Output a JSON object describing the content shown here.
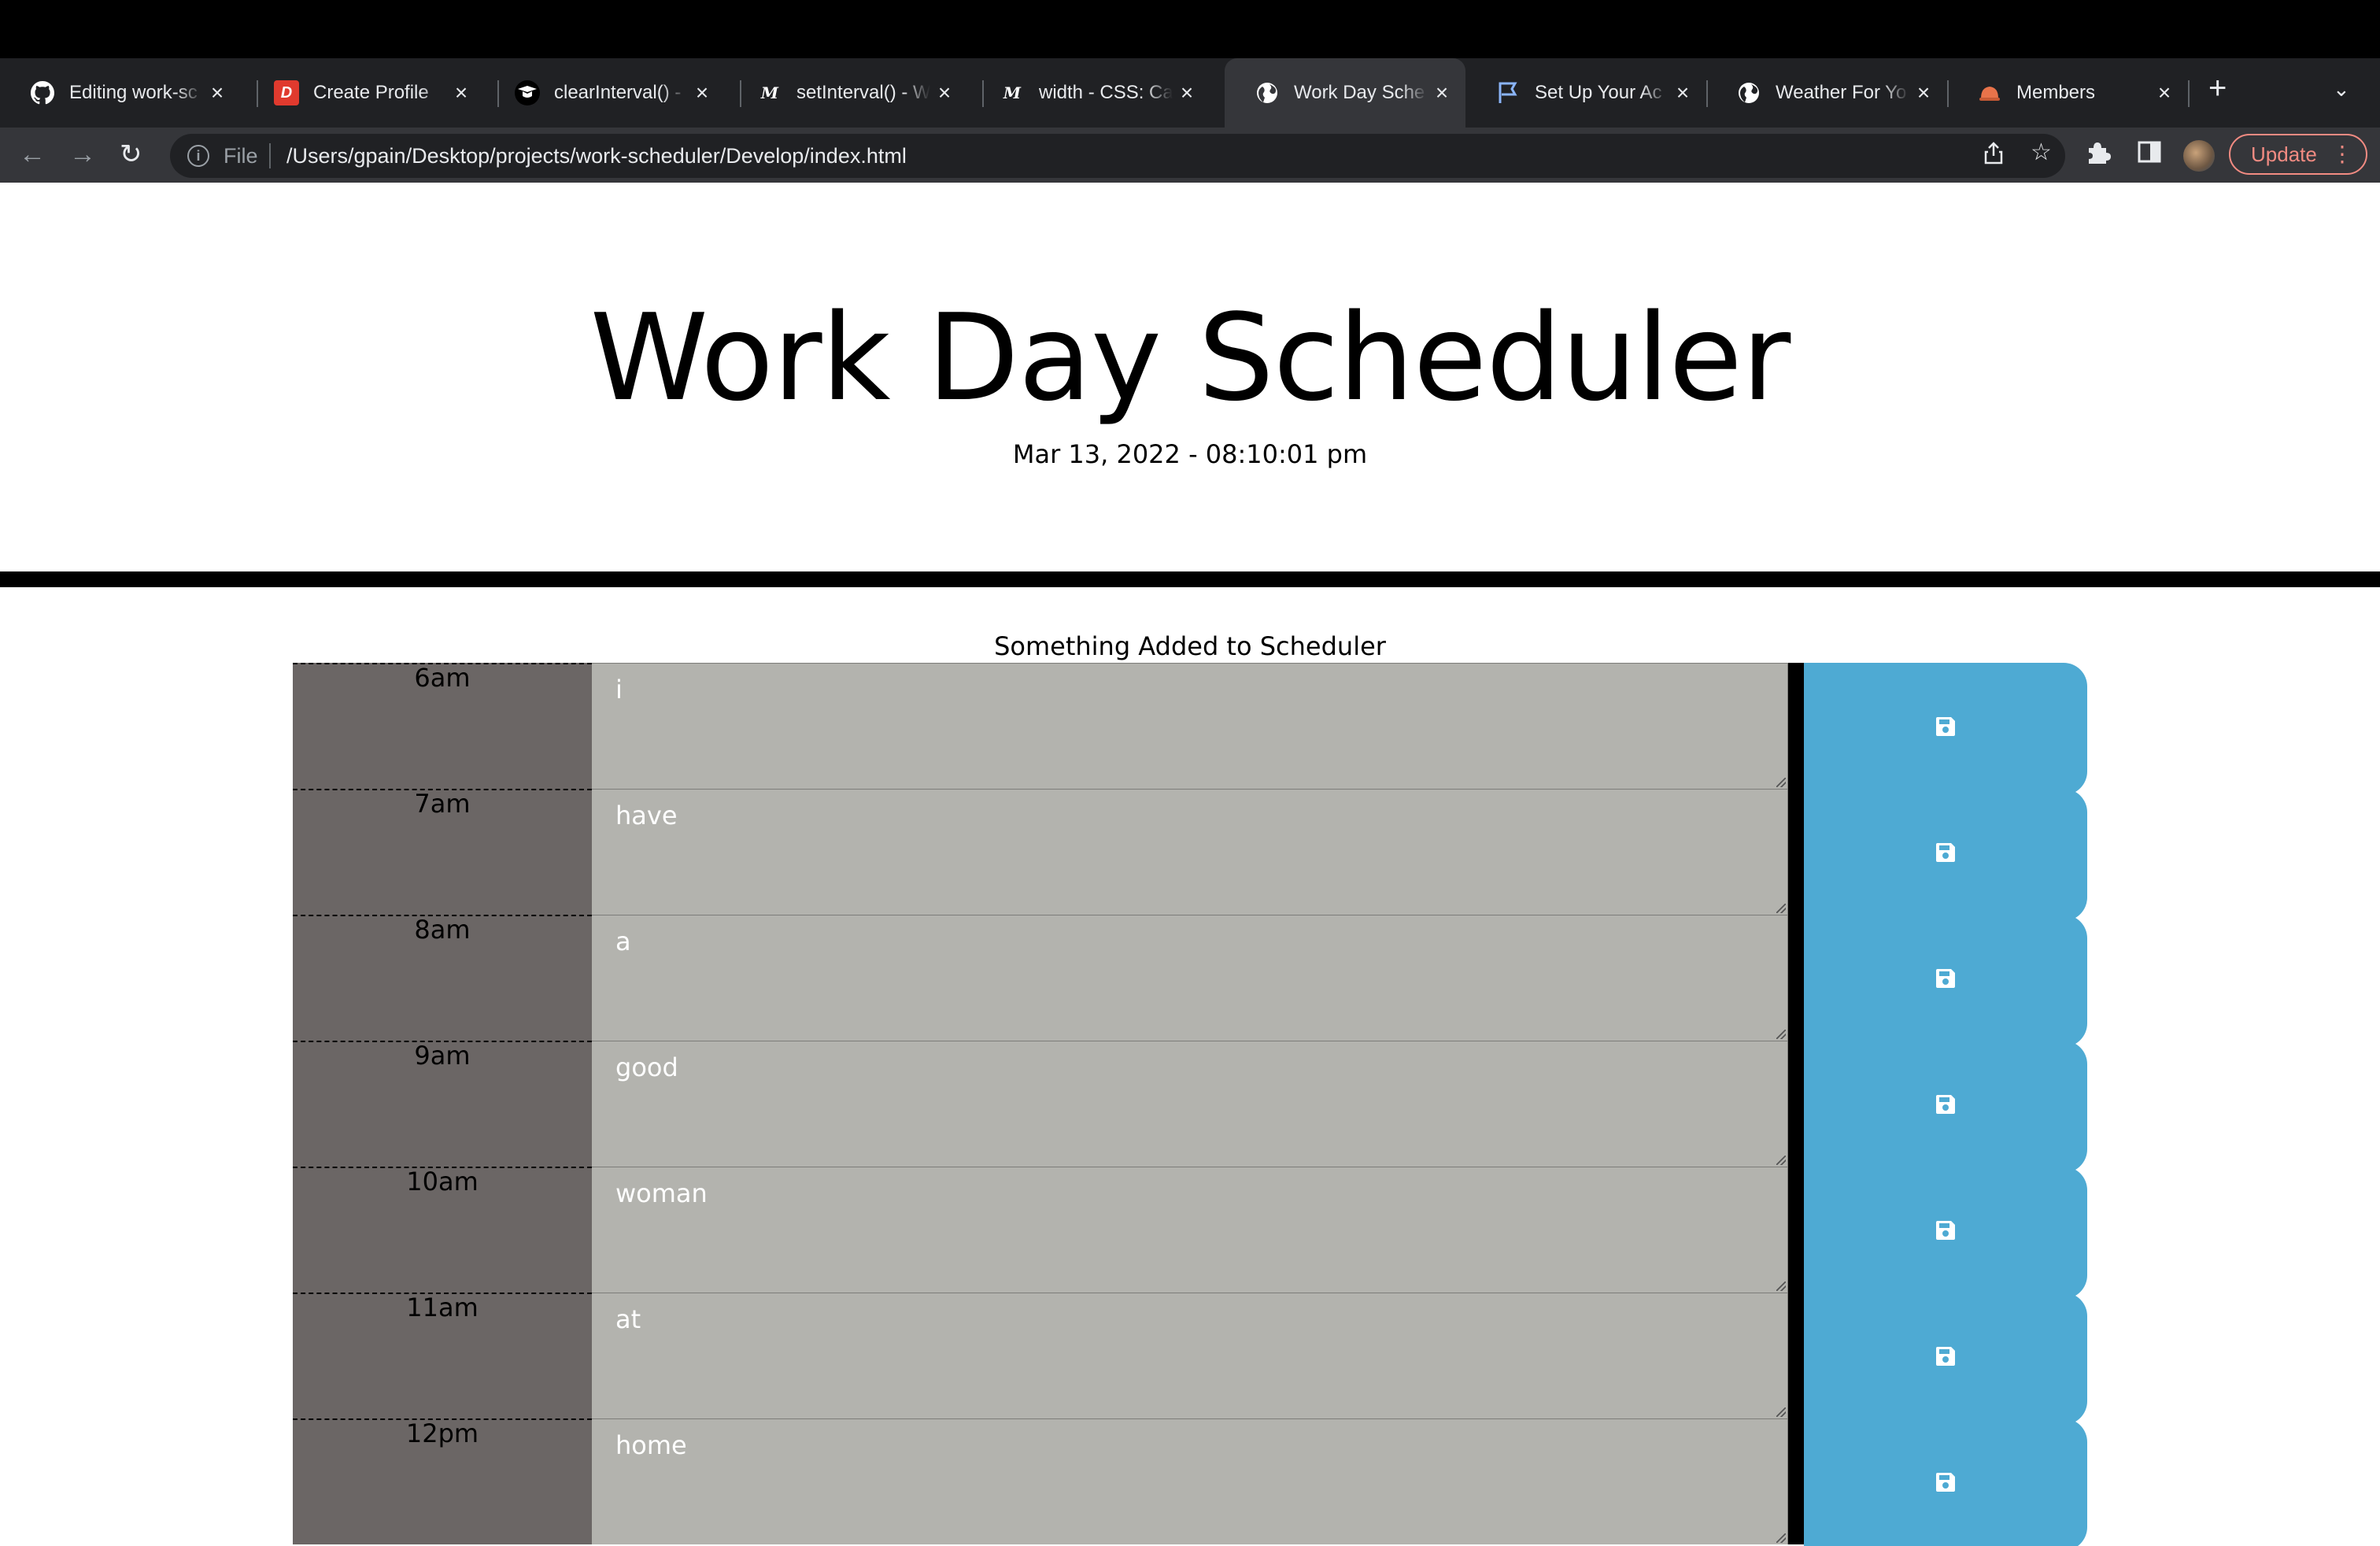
{
  "browser": {
    "tabs": [
      {
        "title": "Editing work-sc",
        "icon": "github-icon",
        "active": false
      },
      {
        "title": "Create Profile",
        "icon": "dev-logo-icon",
        "active": false
      },
      {
        "title": "clearInterval() -",
        "icon": "w3schools-icon",
        "active": false
      },
      {
        "title": "setInterval() - W",
        "icon": "mdn-icon",
        "active": false
      },
      {
        "title": "width - CSS: Ca",
        "icon": "mdn-icon",
        "active": false
      },
      {
        "title": "Work Day Sche",
        "icon": "globe-icon",
        "active": true
      },
      {
        "title": "Set Up Your Ac",
        "icon": "flag-icon",
        "active": false
      },
      {
        "title": "Weather For Yo",
        "icon": "globe-icon",
        "active": false
      },
      {
        "title": "Members",
        "icon": "bootcamp-icon",
        "active": false
      }
    ],
    "address": {
      "scheme": "File",
      "url": "/Users/gpain/Desktop/projects/work-scheduler/Develop/index.html"
    },
    "update_label": "Update"
  },
  "header": {
    "title": "Work Day Scheduler",
    "current_day": "Mar 13, 2022 - 08:10:01 pm"
  },
  "status_message": "Something Added to Scheduler",
  "schedule": [
    {
      "hour": "6am",
      "text": "i"
    },
    {
      "hour": "7am",
      "text": "have"
    },
    {
      "hour": "8am",
      "text": "a"
    },
    {
      "hour": "9am",
      "text": "good"
    },
    {
      "hour": "10am",
      "text": "woman"
    },
    {
      "hour": "11am",
      "text": "at"
    },
    {
      "hour": "12pm",
      "text": "home"
    }
  ],
  "colors": {
    "hour_bg": "#6b6665",
    "past_bg": "#b3b3ae",
    "save_button": "#4eaad3"
  }
}
